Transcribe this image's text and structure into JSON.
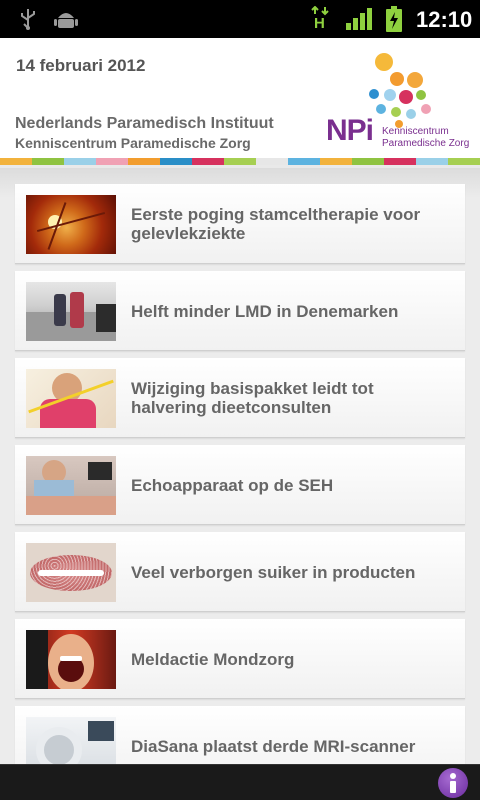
{
  "status_bar": {
    "time": "12:10",
    "data_indicator": "H",
    "icons": [
      "usb-icon",
      "android-debug-icon",
      "hspa-data-icon",
      "signal-strength-icon",
      "battery-charging-icon"
    ]
  },
  "header": {
    "date": "14 februari 2012",
    "org_name": "Nederlands Paramedisch Instituut",
    "org_subtitle": "Kenniscentrum Paramedische Zorg",
    "logo": {
      "letters": "NPi",
      "line1": "Kenniscentrum",
      "line2": "Paramedische Zorg"
    },
    "stripe_colors": [
      "#f2b23c",
      "#8fc341",
      "#9ad0e8",
      "#f0a1b4",
      "#f29d2e",
      "#2a8ec7",
      "#d6315e",
      "#a6cf52",
      "#e7e7e7",
      "#5db3e0",
      "#f2b23c",
      "#8fc341",
      "#d6315e",
      "#9ad0e8",
      "#a6cf52"
    ]
  },
  "news": [
    {
      "title": "Eerste poging stamceltherapie voor gelevlekziekte",
      "thumb": "retina-photo"
    },
    {
      "title": "Helft minder LMD in Denemarken",
      "thumb": "street-people-photo"
    },
    {
      "title": "Wijziging basispakket leidt tot halvering dieetconsulten",
      "thumb": "measuring-tape-woman-photo"
    },
    {
      "title": "Echoapparaat op de SEH",
      "thumb": "ultrasound-exam-photo"
    },
    {
      "title": "Veel verborgen suiker in producten",
      "thumb": "sugar-lips-photo"
    },
    {
      "title": "Meldactie Mondzorg",
      "thumb": "open-mouth-photo"
    },
    {
      "title": "DiaSana plaatst derde MRI-scanner",
      "thumb": "mri-scanner-photo"
    }
  ],
  "bottom_bar": {
    "info_icon": "info-icon"
  },
  "colors": {
    "title_text": "#666666",
    "logo_purple": "#7a2f8f",
    "logo_teal": "#1a9aa0",
    "info_purple": "#6a2b9e"
  }
}
